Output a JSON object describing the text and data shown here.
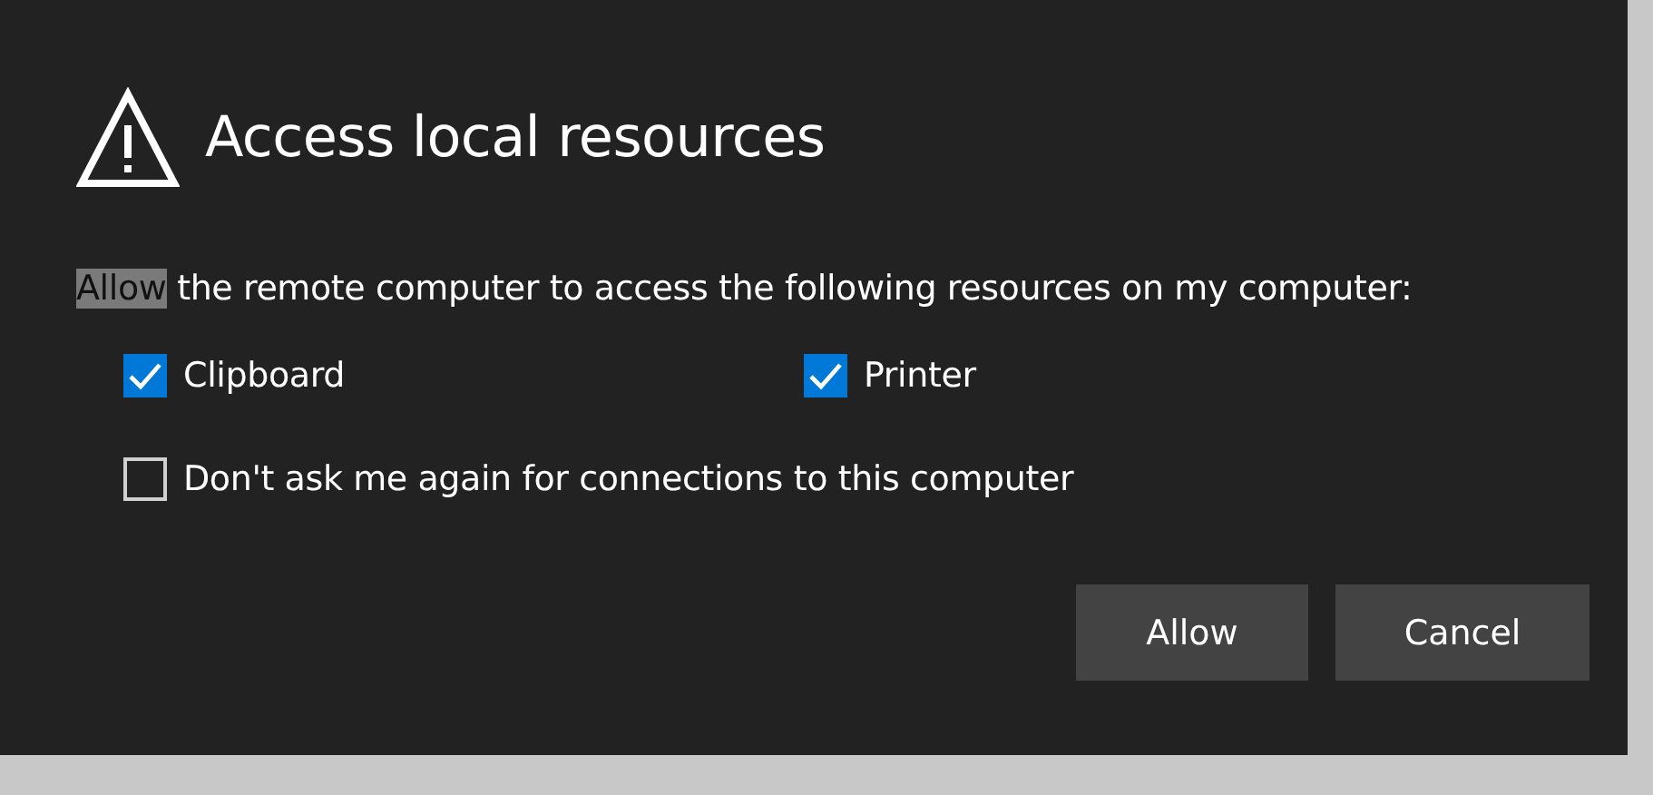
{
  "dialog": {
    "title": "Access local resources",
    "message": {
      "selected_text": "Allow",
      "text": "the remote computer to access the following resources on my computer:"
    },
    "resources": [
      {
        "label": "Clipboard",
        "checked": true
      },
      {
        "label": "Printer",
        "checked": true
      }
    ],
    "dont_ask": {
      "label": "Don't ask me again for connections to this computer",
      "checked": false
    },
    "buttons": [
      "Allow",
      "Cancel"
    ]
  }
}
